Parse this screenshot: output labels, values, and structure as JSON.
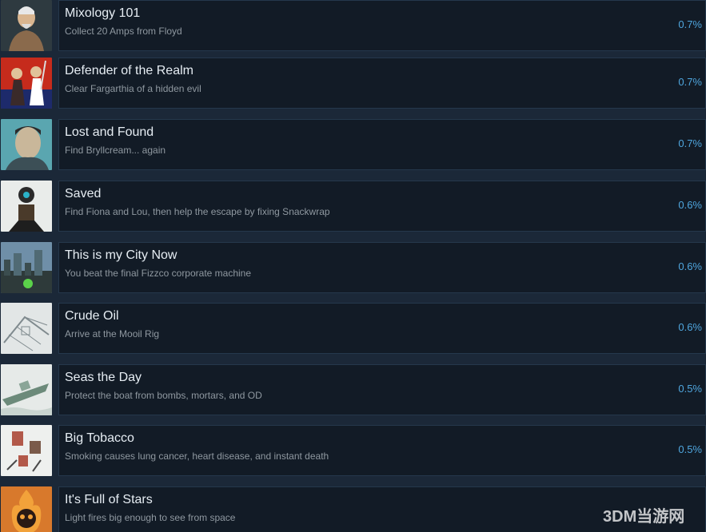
{
  "achievements": [
    {
      "title": "Mixology 101",
      "description": "Collect 20 Amps from Floyd",
      "percent": "0.7%",
      "icon": "bartender-portrait-icon",
      "bg": "#2e3a40",
      "fg": "#8a6a4c"
    },
    {
      "title": "Defender of the Realm",
      "description": "Clear Fargarthia of a hidden evil",
      "percent": "0.7%",
      "icon": "knights-on-red-icon",
      "bg": "#c62b1c",
      "fg": "#3a2a2a"
    },
    {
      "title": "Lost and Found",
      "description": "Find Bryllcream... again",
      "percent": "0.7%",
      "icon": "man-portrait-icon",
      "bg": "#5aa6b0",
      "fg": "#c9b79a"
    },
    {
      "title": "Saved",
      "description": "Find Fiona and Lou, then help the escape by fixing Snackwrap",
      "percent": "0.6%",
      "icon": "robot-icon",
      "bg": "#e9ecea",
      "fg": "#2a2a2a"
    },
    {
      "title": "This is my City Now",
      "description": "You beat the final Fizzco corporate machine",
      "percent": "0.6%",
      "icon": "city-skyline-icon",
      "bg": "#6f8fa8",
      "fg": "#3b4d4f"
    },
    {
      "title": "Crude Oil",
      "description": "Arrive at the Mooil Rig",
      "percent": "0.6%",
      "icon": "oil-rig-sketch-icon",
      "bg": "#e2e6e6",
      "fg": "#7f8a8e"
    },
    {
      "title": "Seas the Day",
      "description": "Protect the boat from bombs, mortars, and OD",
      "percent": "0.5%",
      "icon": "boat-icon",
      "bg": "#e6eae8",
      "fg": "#6c8a7a"
    },
    {
      "title": "Big Tobacco",
      "description": "Smoking causes lung cancer, heart disease, and instant death",
      "percent": "0.5%",
      "icon": "tobacco-machines-icon",
      "bg": "#eef0ee",
      "fg": "#b2594a"
    },
    {
      "title": "It's Full of Stars",
      "description": "Light fires big enough to see from space",
      "percent": "",
      "icon": "flaming-skull-icon",
      "bg": "#d8792c",
      "fg": "#2a1a14"
    }
  ],
  "watermark": {
    "text": "3DM当游网"
  },
  "colors": {
    "page_bg": "#1b2838",
    "panel_bg": "#121b26",
    "panel_border": "#25384c",
    "percent": "#4fa6de"
  }
}
